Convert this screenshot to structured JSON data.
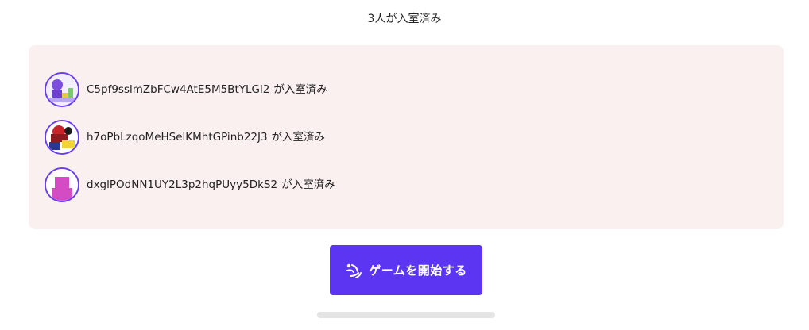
{
  "room": {
    "count_text": "3人が入室済み"
  },
  "players": [
    {
      "name": "C5pf9sslmZbFCw4AtE5M5BtYLGl2",
      "status": "が入室済み",
      "avatar_icon": "purple-figure-avatar-icon"
    },
    {
      "name": "h7oPbLzqoMeHSelKMhtGPinb22J3",
      "status": "が入室済み",
      "avatar_icon": "red-character-avatar-icon"
    },
    {
      "name": "dxglPOdNN1UY2L3p2hqPUyy5DkS2",
      "status": "が入室済み",
      "avatar_icon": "pink-block-avatar-icon"
    }
  ],
  "start_button": {
    "label": "ゲームを開始する",
    "icon": "signal-wave-icon"
  },
  "colors": {
    "accent": "#5b35f2",
    "panel_bg": "#faf0ef",
    "avatar_border": "#6a3df0"
  }
}
